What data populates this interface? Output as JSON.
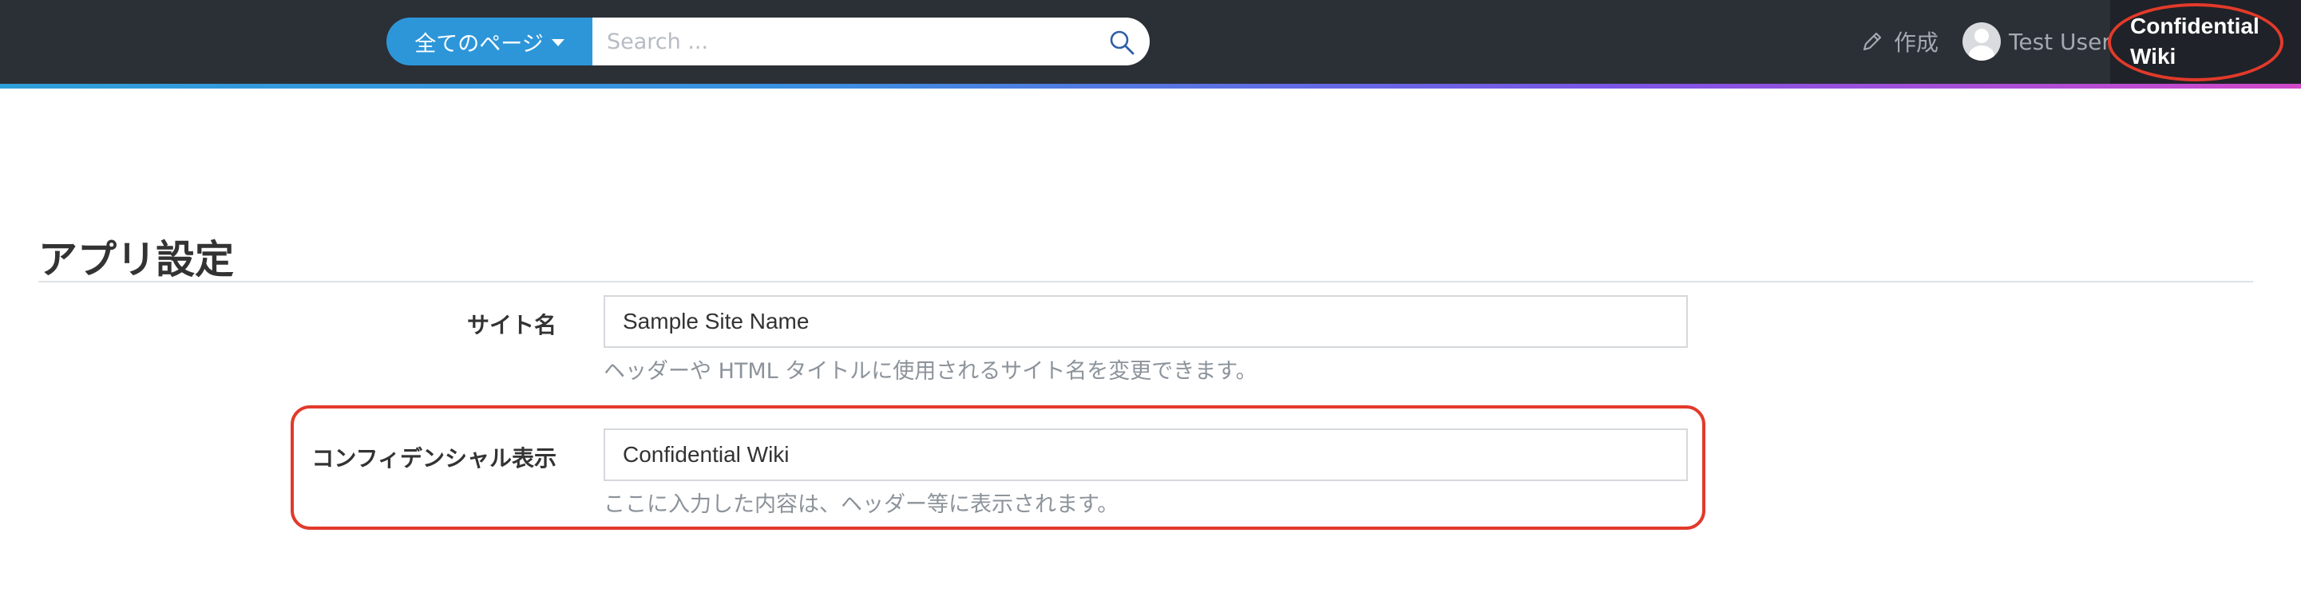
{
  "navbar": {
    "scope_label": "全てのページ",
    "search_placeholder": "Search ...",
    "create_label": "作成",
    "user_name": "Test User",
    "confidential_line1": "Confidential",
    "confidential_line2": "Wiki"
  },
  "page": {
    "title": "アプリ設定"
  },
  "form": {
    "site_name": {
      "label": "サイト名",
      "value": "Sample Site Name",
      "help": "ヘッダーや HTML タイトルに使用されるサイト名を変更できます。"
    },
    "confidential": {
      "label": "コンフィデンシャル表示",
      "value": "Confidential Wiki",
      "help": "ここに入力した内容は、ヘッダー等に表示されます。"
    }
  },
  "colors": {
    "navbar_bg": "#2b2f36",
    "accent_blue": "#2d96d9",
    "annotation_red": "#e23a2a"
  },
  "icons": {
    "search": "search-icon",
    "create": "pencil-icon",
    "avatar": "user-avatar-icon",
    "caret": "caret-down-icon"
  }
}
